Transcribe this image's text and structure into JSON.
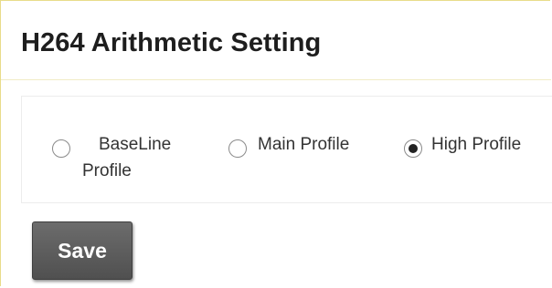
{
  "section": {
    "title": "H264 Arithmetic Setting"
  },
  "profile_options": {
    "selected": "High Profile",
    "items": [
      {
        "label": "BaseLine Profile",
        "checked": false
      },
      {
        "label": "Main Profile",
        "checked": false
      },
      {
        "label": "High Profile",
        "checked": true
      }
    ]
  },
  "actions": {
    "save_label": "Save"
  },
  "colors": {
    "frame_border": "#e8dc8a",
    "button_bg": "#5d5d5d",
    "button_text": "#ffffff",
    "text": "#333333"
  }
}
